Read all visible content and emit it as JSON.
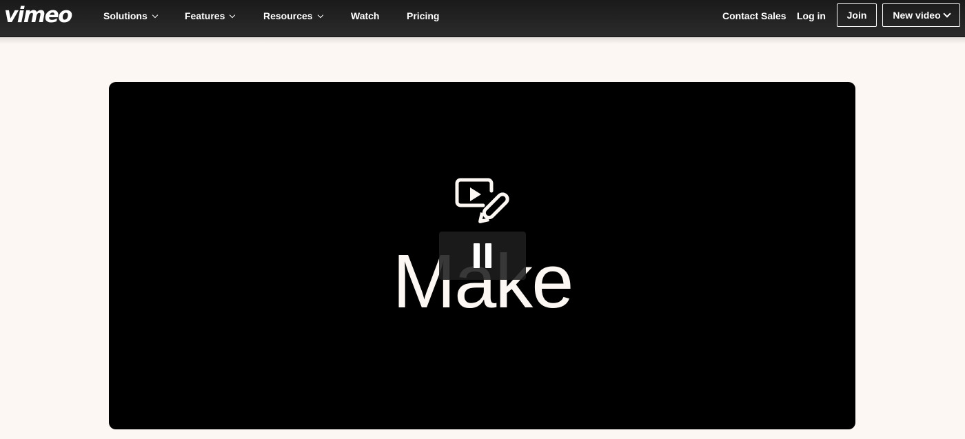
{
  "brand": {
    "logo_text": "vimeo"
  },
  "nav": {
    "solutions": "Solutions",
    "features": "Features",
    "resources": "Resources",
    "watch": "Watch",
    "pricing": "Pricing"
  },
  "actions": {
    "contact_sales": "Contact Sales",
    "log_in": "Log in",
    "join": "Join",
    "new_video": "New video"
  },
  "video": {
    "title_text": "Make",
    "state": "playing",
    "control": "pause-icon"
  },
  "colors": {
    "topbar_bg": "#1a1a1a",
    "page_bg": "#fcf7f2",
    "video_bg": "#000000",
    "text_light": "#ffffff"
  }
}
